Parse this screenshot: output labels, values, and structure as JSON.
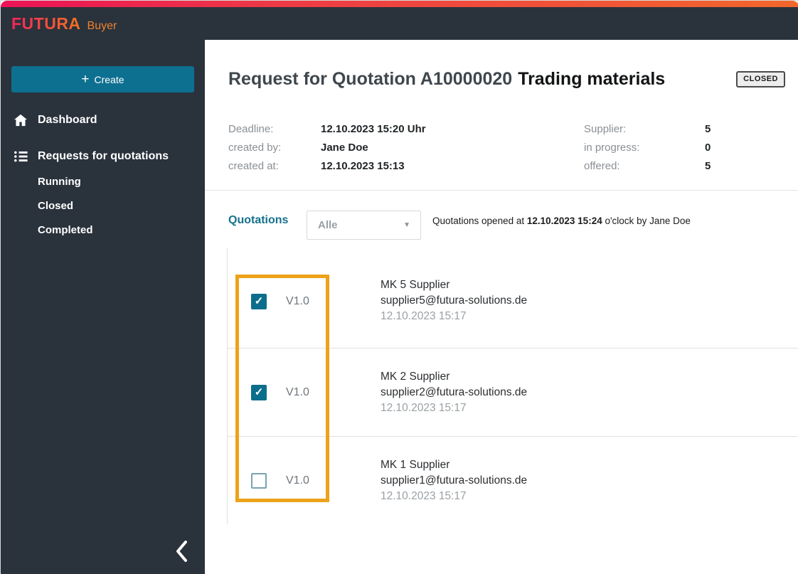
{
  "colors": {
    "topbar_gradient_left": "#ec1356",
    "topbar_gradient_right": "#f2672b",
    "chrome_dark": "#2a323c",
    "accent_teal": "#0e7090",
    "highlight_orange": "#eda21a"
  },
  "icons": {
    "plus": "+",
    "caret_down": "▼",
    "chevron_left": "❮",
    "check": "✓"
  },
  "brand": {
    "name": "FUTURA",
    "suffix": "Buyer"
  },
  "sidebar": {
    "create_label": "Create",
    "items": [
      {
        "icon": "home-icon",
        "label": "Dashboard"
      },
      {
        "icon": "bulleted-list-icon",
        "label": "Requests for quotations"
      }
    ],
    "subitems": [
      {
        "label": "Running"
      },
      {
        "label": "Closed"
      },
      {
        "label": "Completed"
      }
    ]
  },
  "header": {
    "title_prefix": "Request for Quotation A10000020",
    "title_name": "Trading materials",
    "status_badge": "CLOSED"
  },
  "details": {
    "left": [
      {
        "label": "Deadline:",
        "value": "12.10.2023 15:20 Uhr"
      },
      {
        "label": "created by:",
        "value": "Jane Doe"
      },
      {
        "label": "created at:",
        "value": "12.10.2023 15:13"
      }
    ],
    "right": [
      {
        "label": "Supplier:",
        "value": "5"
      },
      {
        "label": "in progress:",
        "value": "0"
      },
      {
        "label": "offered:",
        "value": "5"
      }
    ]
  },
  "quotations": {
    "section_label": "Quotations",
    "filter_value": "Alle",
    "opened_prefix": "Quotations opened at ",
    "opened_datetime": "12.10.2023 15:24",
    "opened_suffix": " o'clock by Jane Doe",
    "rows": [
      {
        "checked": true,
        "version": "V1.0",
        "name": "MK 5 Supplier",
        "email": "supplier5@futura-solutions.de",
        "date": "12.10.2023 15:17"
      },
      {
        "checked": true,
        "version": "V1.0",
        "name": "MK 2 Supplier",
        "email": "supplier2@futura-solutions.de",
        "date": "12.10.2023 15:17"
      },
      {
        "checked": false,
        "version": "V1.0",
        "name": "MK 1 Supplier",
        "email": "supplier1@futura-solutions.de",
        "date": "12.10.2023 15:17"
      }
    ]
  }
}
